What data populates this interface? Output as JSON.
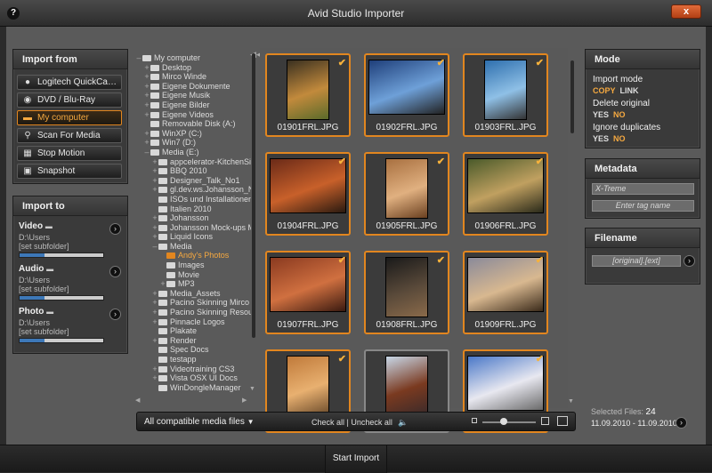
{
  "window": {
    "title": "Avid Studio Importer",
    "help": "?",
    "close": "x"
  },
  "import_from": {
    "header": "Import from",
    "sources": [
      {
        "label": "Logitech QuickCam E...",
        "icon": "webcam-icon"
      },
      {
        "label": "DVD / Blu-Ray",
        "icon": "disc-icon"
      },
      {
        "label": "My computer",
        "icon": "folder-icon",
        "active": true
      },
      {
        "label": "Scan For Media",
        "icon": "magnifier-icon"
      },
      {
        "label": "Stop Motion",
        "icon": "film-icon"
      },
      {
        "label": "Snapshot",
        "icon": "camera-icon"
      }
    ]
  },
  "import_to": {
    "header": "Import to",
    "targets": [
      {
        "label": "Video",
        "path": "D:\\Users",
        "sub": "[set subfolder]",
        "fill": 0.3
      },
      {
        "label": "Audio",
        "path": "D:\\Users",
        "sub": "[set subfolder]",
        "fill": 0.3
      },
      {
        "label": "Photo",
        "path": "D:\\Users",
        "sub": "[set subfolder]",
        "fill": 0.3
      }
    ]
  },
  "tree": [
    {
      "label": "My computer",
      "exp": "–",
      "indent": 0
    },
    {
      "label": "Desktop",
      "exp": "+",
      "indent": 1
    },
    {
      "label": "Mirco Winde",
      "exp": "+",
      "indent": 1
    },
    {
      "label": "Eigene Dokumente",
      "exp": "+",
      "indent": 1
    },
    {
      "label": "Eigene Musik",
      "exp": "+",
      "indent": 1
    },
    {
      "label": "Eigene Bilder",
      "exp": "+",
      "indent": 1
    },
    {
      "label": "Eigene Videos",
      "exp": "+",
      "indent": 1
    },
    {
      "label": "Removable Disk (A:)",
      "exp": "",
      "indent": 1
    },
    {
      "label": "WinXP (C:)",
      "exp": "+",
      "indent": 1
    },
    {
      "label": "Win7 (D:)",
      "exp": "+",
      "indent": 1
    },
    {
      "label": "Media (E:)",
      "exp": "–",
      "indent": 1
    },
    {
      "label": "appcelerator-KitchenSink-",
      "exp": "+",
      "indent": 2
    },
    {
      "label": "BBQ 2010",
      "exp": "+",
      "indent": 2
    },
    {
      "label": "Designer_Talk_No1",
      "exp": "+",
      "indent": 2
    },
    {
      "label": "gl.dev.ws.Johansson_NG_",
      "exp": "+",
      "indent": 2
    },
    {
      "label": "ISOs und Installationen",
      "exp": "",
      "indent": 2
    },
    {
      "label": "Italien 2010",
      "exp": "",
      "indent": 2
    },
    {
      "label": "Johansson",
      "exp": "+",
      "indent": 2
    },
    {
      "label": "Johansson Mock-ups Mirc",
      "exp": "+",
      "indent": 2
    },
    {
      "label": "Liquid Icons",
      "exp": "+",
      "indent": 2
    },
    {
      "label": "Media",
      "exp": "–",
      "indent": 2
    },
    {
      "label": "Andy's Photos",
      "exp": "",
      "indent": 3,
      "selected": true
    },
    {
      "label": "Images",
      "exp": "",
      "indent": 3
    },
    {
      "label": "Movie",
      "exp": "",
      "indent": 3
    },
    {
      "label": "MP3",
      "exp": "+",
      "indent": 3
    },
    {
      "label": "Media_Assets",
      "exp": "+",
      "indent": 2
    },
    {
      "label": "Pacino Skinning Mirco",
      "exp": "+",
      "indent": 2
    },
    {
      "label": "Pacino Skinning Resource",
      "exp": "+",
      "indent": 2
    },
    {
      "label": "Pinnacle Logos",
      "exp": "+",
      "indent": 2
    },
    {
      "label": "Plakate",
      "exp": "",
      "indent": 2
    },
    {
      "label": "Render",
      "exp": "+",
      "indent": 2
    },
    {
      "label": "Spec Docs",
      "exp": "",
      "indent": 2
    },
    {
      "label": "testapp",
      "exp": "",
      "indent": 2
    },
    {
      "label": "Videotraining CS3",
      "exp": "+",
      "indent": 2
    },
    {
      "label": "Vista OSX UI Docs",
      "exp": "+",
      "indent": 2
    },
    {
      "label": "WinDongleManager",
      "exp": "",
      "indent": 2
    }
  ],
  "thumbnails": [
    {
      "name": "01901FRL.JPG",
      "checked": true,
      "colors": [
        "#3a3020",
        "#c28a3c",
        "#5a6a2a"
      ],
      "portrait": true
    },
    {
      "name": "01902FRL.JPG",
      "checked": true,
      "colors": [
        "#1f3f7a",
        "#6ea0d8",
        "#222"
      ],
      "portrait": false
    },
    {
      "name": "01903FRL.JPG",
      "checked": true,
      "colors": [
        "#2e6fae",
        "#8fc0e6",
        "#333"
      ],
      "portrait": true
    },
    {
      "name": "01904FRL.JPG",
      "checked": true,
      "colors": [
        "#6a2a18",
        "#c8602a",
        "#2a1a10"
      ],
      "portrait": false
    },
    {
      "name": "01905FRL.JPG",
      "checked": true,
      "colors": [
        "#a87040",
        "#e0b080",
        "#6a4020"
      ],
      "portrait": true
    },
    {
      "name": "01906FRL.JPG",
      "checked": true,
      "colors": [
        "#4a5a2a",
        "#c0a060",
        "#2a2a1a"
      ],
      "portrait": false
    },
    {
      "name": "01907FRL.JPG",
      "checked": true,
      "colors": [
        "#8a3a20",
        "#d07040",
        "#3a1a10"
      ],
      "portrait": false
    },
    {
      "name": "01908FRL.JPG",
      "checked": true,
      "colors": [
        "#1a1a1a",
        "#5a4a3a",
        "#8a6a4a"
      ],
      "portrait": true
    },
    {
      "name": "01909FRL.JPG",
      "checked": true,
      "colors": [
        "#8a8a9a",
        "#d8b890",
        "#3a2a1a"
      ],
      "portrait": false
    },
    {
      "name": "",
      "checked": true,
      "colors": [
        "#c07a3a",
        "#e8b070",
        "#6a4a2a"
      ],
      "portrait": true
    },
    {
      "name": "",
      "checked": false,
      "colors": [
        "#c8d8e8",
        "#7a3a20",
        "#3a2a2a"
      ],
      "portrait": true,
      "plain": true
    },
    {
      "name": "",
      "checked": true,
      "colors": [
        "#4a78c8",
        "#e8e8f0",
        "#6a6a6a"
      ],
      "portrait": false
    }
  ],
  "filter_bar": {
    "filter": "All compatible media files",
    "check_all": "Check all",
    "uncheck_all": "Uncheck all"
  },
  "mode": {
    "header": "Mode",
    "import_mode": {
      "label": "Import mode",
      "opts": [
        "COPY",
        "LINK"
      ],
      "active": 0
    },
    "delete_original": {
      "label": "Delete original",
      "opts": [
        "YES",
        "NO"
      ],
      "active": 1
    },
    "ignore_duplicates": {
      "label": "Ignore duplicates",
      "opts": [
        "YES",
        "NO"
      ],
      "active": 1
    }
  },
  "metadata": {
    "header": "Metadata",
    "value": "X-Treme",
    "tag_placeholder": "Enter tag name"
  },
  "filename": {
    "header": "Filename",
    "pattern": "[original].[ext]"
  },
  "selection": {
    "label": "Selected Files:",
    "count": "24",
    "range": "11.09.2010 - 11.09.2010"
  },
  "start": {
    "label": "Start Import"
  }
}
